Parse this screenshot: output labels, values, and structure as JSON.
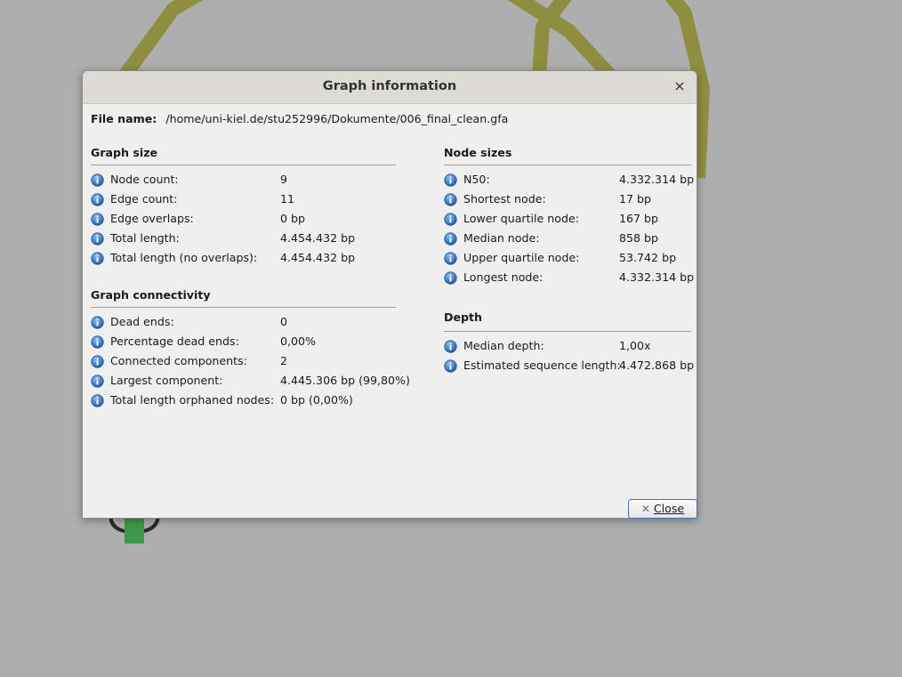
{
  "dialog": {
    "title": "Graph information",
    "close_icon": "×",
    "file_label": "File name:",
    "file_path": "/home/uni-kiel.de/stu252996/Dokumente/006_final_clean.gfa"
  },
  "graph_size": {
    "title": "Graph size",
    "rows": [
      {
        "label": "Node count:",
        "value": "9"
      },
      {
        "label": "Edge count:",
        "value": "11"
      },
      {
        "label": "Edge overlaps:",
        "value": "0 bp"
      },
      {
        "label": "Total length:",
        "value": "4.454.432 bp"
      },
      {
        "label": "Total length (no overlaps):",
        "value": "4.454.432 bp"
      }
    ]
  },
  "graph_connectivity": {
    "title": "Graph connectivity",
    "rows": [
      {
        "label": "Dead ends:",
        "value": "0"
      },
      {
        "label": "Percentage dead ends:",
        "value": "0,00%"
      },
      {
        "label": "Connected components:",
        "value": "2"
      },
      {
        "label": "Largest component:",
        "value": "4.445.306 bp (99,80%)"
      },
      {
        "label": "Total length orphaned nodes:",
        "value": "0 bp (0,00%)"
      }
    ]
  },
  "node_sizes": {
    "title": "Node sizes",
    "rows": [
      {
        "label": "N50:",
        "value": "4.332.314 bp"
      },
      {
        "label": "Shortest node:",
        "value": "17 bp"
      },
      {
        "label": "Lower quartile node:",
        "value": "167 bp"
      },
      {
        "label": "Median node:",
        "value": "858 bp"
      },
      {
        "label": "Upper quartile node:",
        "value": "53.742 bp"
      },
      {
        "label": "Longest node:",
        "value": "4.332.314 bp"
      }
    ]
  },
  "depth": {
    "title": "Depth",
    "rows": [
      {
        "label": "Median depth:",
        "value": "1,00x"
      },
      {
        "label": "Estimated sequence length:",
        "value": "4.472.868 bp"
      }
    ]
  },
  "buttons": {
    "close_label": "Close",
    "close_icon": "✕"
  },
  "colors": {
    "background": "#aeaeae",
    "graph_edge": "#8d8d3c",
    "graph_node_green": "#3d9a4a",
    "info_icon": "#2f6fb8"
  }
}
